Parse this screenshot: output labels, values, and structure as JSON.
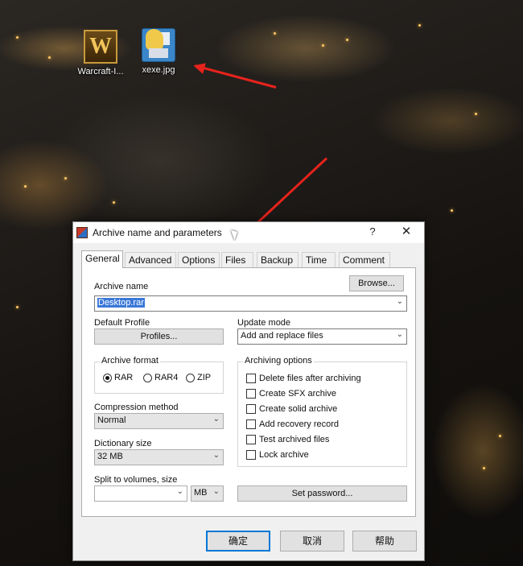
{
  "desktop": {
    "icons": [
      {
        "label": "Warcraft-I...",
        "icon": "warcraft-icon"
      },
      {
        "label": "xexe.jpg",
        "icon": "image-file-icon"
      }
    ]
  },
  "dialog": {
    "title": "Archive name and parameters",
    "help_label": "?",
    "close_label": "✕",
    "tabs": [
      "General",
      "Advanced",
      "Options",
      "Files",
      "Backup",
      "Time",
      "Comment"
    ],
    "active_tab": "General",
    "archive_name_label": "Archive name",
    "browse_label": "Browse...",
    "archive_name_value": "Desktop.rar",
    "default_profile_label": "Default Profile",
    "profiles_label": "Profiles...",
    "update_mode_label": "Update mode",
    "update_mode_value": "Add and replace files",
    "archive_format_label": "Archive format",
    "formats": [
      "RAR",
      "RAR4",
      "ZIP"
    ],
    "selected_format": "RAR",
    "archiving_options_label": "Archiving options",
    "options": [
      "Delete files after archiving",
      "Create SFX archive",
      "Create solid archive",
      "Add recovery record",
      "Test archived files",
      "Lock archive"
    ],
    "compression_method_label": "Compression method",
    "compression_method_value": "Normal",
    "dictionary_size_label": "Dictionary size",
    "dictionary_size_value": "32 MB",
    "split_label": "Split to volumes, size",
    "split_value": "",
    "split_unit": "MB",
    "set_password_label": "Set password...",
    "buttons": {
      "ok": "确定",
      "cancel": "取消",
      "help": "帮助"
    }
  },
  "colors": {
    "arrow": "#e8231c",
    "selection": "#3b78d8",
    "default_button_border": "#0078d7"
  }
}
